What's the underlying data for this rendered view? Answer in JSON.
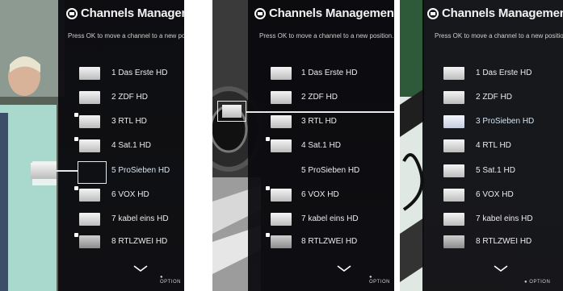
{
  "screens": [
    {
      "title": "Channels Management",
      "help": "Press OK to move a channel to a new position.",
      "channels": [
        {
          "label": "1 Das Erste HD"
        },
        {
          "label": "2 ZDF HD"
        },
        {
          "label": "3 RTL HD"
        },
        {
          "label": "4 Sat.1 HD"
        },
        {
          "label": "5 ProSieben HD"
        },
        {
          "label": "6 VOX HD"
        },
        {
          "label": "7 kabel eins HD"
        },
        {
          "label": "8 RTLZWEI HD"
        }
      ],
      "option_label": "OPTION"
    },
    {
      "title": "Channels Management",
      "help": "Press OK to move a channel to a new position.",
      "channels": [
        {
          "label": "1 Das Erste HD"
        },
        {
          "label": "2 ZDF HD"
        },
        {
          "label": "3 RTL HD"
        },
        {
          "label": "4 Sat.1 HD"
        },
        {
          "label": "5 ProSieben HD"
        },
        {
          "label": "6 VOX HD"
        },
        {
          "label": "7 kabel eins HD"
        },
        {
          "label": "8 RTLZWEI HD"
        }
      ],
      "option_label": "OPTION"
    },
    {
      "title": "Channels Management",
      "help": "Press OK to move a channel to a new position.",
      "channels": [
        {
          "label": "1 Das Erste HD"
        },
        {
          "label": "2 ZDF HD"
        },
        {
          "label": "3 ProSieben HD"
        },
        {
          "label": "4 RTL HD"
        },
        {
          "label": "5 Sat.1 HD"
        },
        {
          "label": "6 VOX HD"
        },
        {
          "label": "7 kabel eins HD"
        },
        {
          "label": "8 RTLZWEI HD"
        }
      ],
      "option_label": "OPTION"
    }
  ]
}
